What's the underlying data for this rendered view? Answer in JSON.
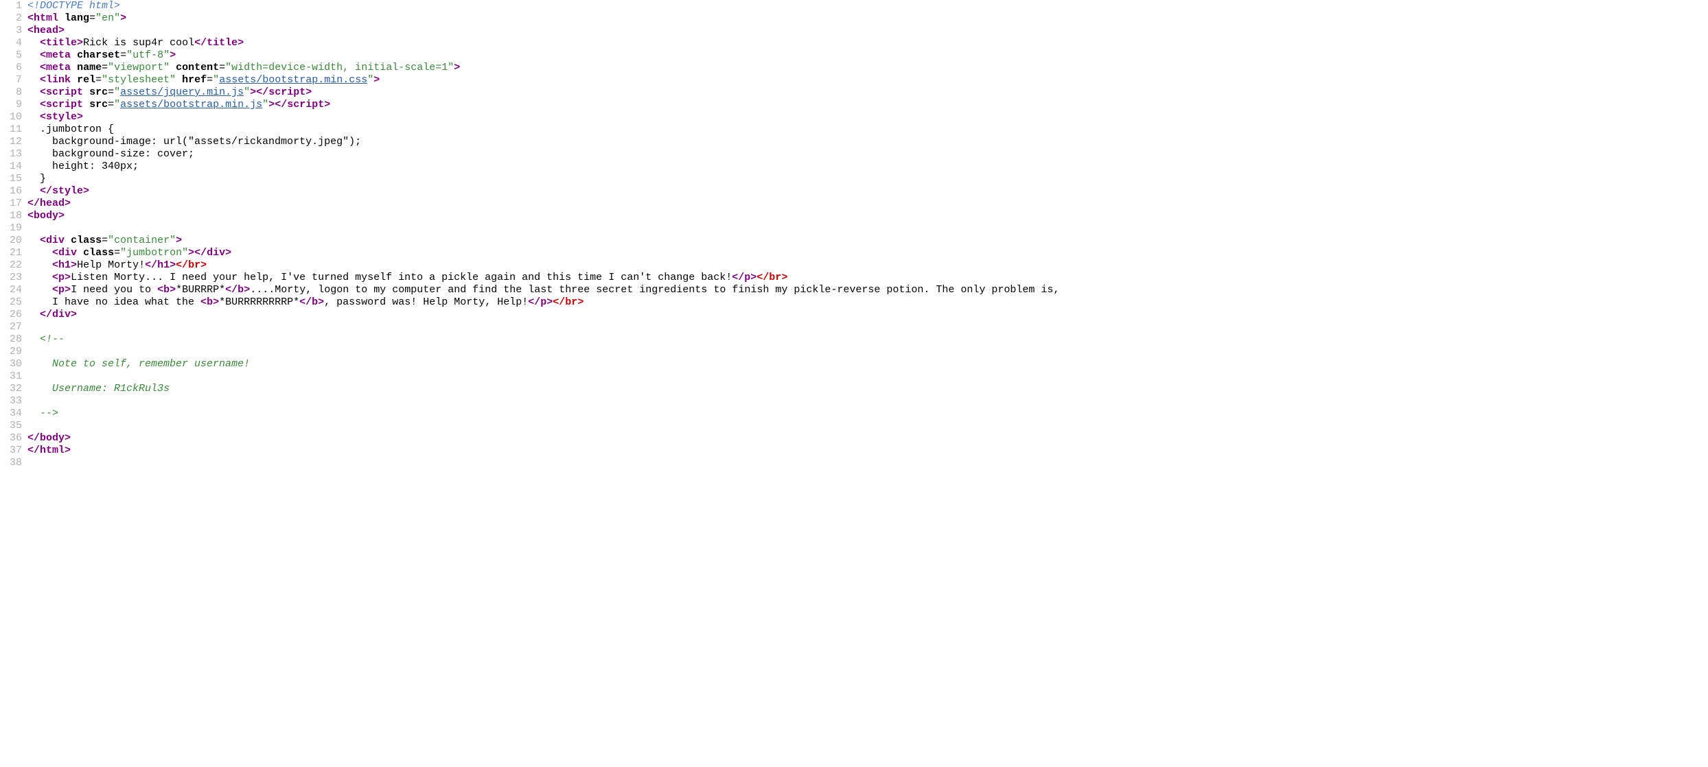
{
  "lines": [
    {
      "n": 1,
      "tokens": [
        {
          "t": "<!DOCTYPE html>",
          "c": "doctype"
        }
      ]
    },
    {
      "n": 2,
      "tokens": [
        {
          "t": "<",
          "c": "tag-bracket"
        },
        {
          "t": "html",
          "c": "tag-name"
        },
        {
          "t": " ",
          "c": "plain"
        },
        {
          "t": "lang",
          "c": "attr-name"
        },
        {
          "t": "=",
          "c": "attr-eq"
        },
        {
          "t": "\"en\"",
          "c": "attr-val"
        },
        {
          "t": ">",
          "c": "tag-bracket"
        }
      ]
    },
    {
      "n": 3,
      "tokens": [
        {
          "t": "<",
          "c": "tag-bracket"
        },
        {
          "t": "head",
          "c": "tag-name"
        },
        {
          "t": ">",
          "c": "tag-bracket"
        }
      ]
    },
    {
      "n": 4,
      "tokens": [
        {
          "t": "  ",
          "c": "plain"
        },
        {
          "t": "<",
          "c": "tag-bracket"
        },
        {
          "t": "title",
          "c": "tag-name"
        },
        {
          "t": ">",
          "c": "tag-bracket"
        },
        {
          "t": "Rick is sup4r cool",
          "c": "plain"
        },
        {
          "t": "</",
          "c": "tag-bracket"
        },
        {
          "t": "title",
          "c": "tag-name"
        },
        {
          "t": ">",
          "c": "tag-bracket"
        }
      ]
    },
    {
      "n": 5,
      "tokens": [
        {
          "t": "  ",
          "c": "plain"
        },
        {
          "t": "<",
          "c": "tag-bracket"
        },
        {
          "t": "meta",
          "c": "tag-name"
        },
        {
          "t": " ",
          "c": "plain"
        },
        {
          "t": "charset",
          "c": "attr-name"
        },
        {
          "t": "=",
          "c": "attr-eq"
        },
        {
          "t": "\"utf-8\"",
          "c": "attr-val"
        },
        {
          "t": ">",
          "c": "tag-bracket"
        }
      ]
    },
    {
      "n": 6,
      "tokens": [
        {
          "t": "  ",
          "c": "plain"
        },
        {
          "t": "<",
          "c": "tag-bracket"
        },
        {
          "t": "meta",
          "c": "tag-name"
        },
        {
          "t": " ",
          "c": "plain"
        },
        {
          "t": "name",
          "c": "attr-name"
        },
        {
          "t": "=",
          "c": "attr-eq"
        },
        {
          "t": "\"viewport\"",
          "c": "attr-val"
        },
        {
          "t": " ",
          "c": "plain"
        },
        {
          "t": "content",
          "c": "attr-name"
        },
        {
          "t": "=",
          "c": "attr-eq"
        },
        {
          "t": "\"width=device-width, initial-scale=1\"",
          "c": "attr-val"
        },
        {
          "t": ">",
          "c": "tag-bracket"
        }
      ]
    },
    {
      "n": 7,
      "tokens": [
        {
          "t": "  ",
          "c": "plain"
        },
        {
          "t": "<",
          "c": "tag-bracket"
        },
        {
          "t": "link",
          "c": "tag-name"
        },
        {
          "t": " ",
          "c": "plain"
        },
        {
          "t": "rel",
          "c": "attr-name"
        },
        {
          "t": "=",
          "c": "attr-eq"
        },
        {
          "t": "\"stylesheet\"",
          "c": "attr-val"
        },
        {
          "t": " ",
          "c": "plain"
        },
        {
          "t": "href",
          "c": "attr-name"
        },
        {
          "t": "=",
          "c": "attr-eq"
        },
        {
          "t": "\"",
          "c": "attr-val"
        },
        {
          "t": "assets/bootstrap.min.css",
          "c": "attr-val-link"
        },
        {
          "t": "\"",
          "c": "attr-val"
        },
        {
          "t": ">",
          "c": "tag-bracket"
        }
      ]
    },
    {
      "n": 8,
      "tokens": [
        {
          "t": "  ",
          "c": "plain"
        },
        {
          "t": "<",
          "c": "tag-bracket"
        },
        {
          "t": "script",
          "c": "tag-name"
        },
        {
          "t": " ",
          "c": "plain"
        },
        {
          "t": "src",
          "c": "attr-name"
        },
        {
          "t": "=",
          "c": "attr-eq"
        },
        {
          "t": "\"",
          "c": "attr-val"
        },
        {
          "t": "assets/jquery.min.js",
          "c": "attr-val-link"
        },
        {
          "t": "\"",
          "c": "attr-val"
        },
        {
          "t": ">",
          "c": "tag-bracket"
        },
        {
          "t": "</",
          "c": "tag-bracket"
        },
        {
          "t": "script",
          "c": "tag-name"
        },
        {
          "t": ">",
          "c": "tag-bracket"
        }
      ]
    },
    {
      "n": 9,
      "tokens": [
        {
          "t": "  ",
          "c": "plain"
        },
        {
          "t": "<",
          "c": "tag-bracket"
        },
        {
          "t": "script",
          "c": "tag-name"
        },
        {
          "t": " ",
          "c": "plain"
        },
        {
          "t": "src",
          "c": "attr-name"
        },
        {
          "t": "=",
          "c": "attr-eq"
        },
        {
          "t": "\"",
          "c": "attr-val"
        },
        {
          "t": "assets/bootstrap.min.js",
          "c": "attr-val-link"
        },
        {
          "t": "\"",
          "c": "attr-val"
        },
        {
          "t": ">",
          "c": "tag-bracket"
        },
        {
          "t": "</",
          "c": "tag-bracket"
        },
        {
          "t": "script",
          "c": "tag-name"
        },
        {
          "t": ">",
          "c": "tag-bracket"
        }
      ]
    },
    {
      "n": 10,
      "tokens": [
        {
          "t": "  ",
          "c": "plain"
        },
        {
          "t": "<",
          "c": "tag-bracket"
        },
        {
          "t": "style",
          "c": "tag-name"
        },
        {
          "t": ">",
          "c": "tag-bracket"
        }
      ]
    },
    {
      "n": 11,
      "tokens": [
        {
          "t": "  .jumbotron {",
          "c": "plain"
        }
      ]
    },
    {
      "n": 12,
      "tokens": [
        {
          "t": "    background-image: url(\"assets/rickandmorty.jpeg\");",
          "c": "plain"
        }
      ]
    },
    {
      "n": 13,
      "tokens": [
        {
          "t": "    background-size: cover;",
          "c": "plain"
        }
      ]
    },
    {
      "n": 14,
      "tokens": [
        {
          "t": "    height: 340px;",
          "c": "plain"
        }
      ]
    },
    {
      "n": 15,
      "tokens": [
        {
          "t": "  }",
          "c": "plain"
        }
      ]
    },
    {
      "n": 16,
      "tokens": [
        {
          "t": "  ",
          "c": "plain"
        },
        {
          "t": "</",
          "c": "tag-bracket"
        },
        {
          "t": "style",
          "c": "tag-name"
        },
        {
          "t": ">",
          "c": "tag-bracket"
        }
      ]
    },
    {
      "n": 17,
      "tokens": [
        {
          "t": "</",
          "c": "tag-bracket"
        },
        {
          "t": "head",
          "c": "tag-name"
        },
        {
          "t": ">",
          "c": "tag-bracket"
        }
      ]
    },
    {
      "n": 18,
      "tokens": [
        {
          "t": "<",
          "c": "tag-bracket"
        },
        {
          "t": "body",
          "c": "tag-name"
        },
        {
          "t": ">",
          "c": "tag-bracket"
        }
      ]
    },
    {
      "n": 19,
      "tokens": []
    },
    {
      "n": 20,
      "tokens": [
        {
          "t": "  ",
          "c": "plain"
        },
        {
          "t": "<",
          "c": "tag-bracket"
        },
        {
          "t": "div",
          "c": "tag-name"
        },
        {
          "t": " ",
          "c": "plain"
        },
        {
          "t": "class",
          "c": "attr-name"
        },
        {
          "t": "=",
          "c": "attr-eq"
        },
        {
          "t": "\"container\"",
          "c": "attr-val"
        },
        {
          "t": ">",
          "c": "tag-bracket"
        }
      ]
    },
    {
      "n": 21,
      "tokens": [
        {
          "t": "    ",
          "c": "plain"
        },
        {
          "t": "<",
          "c": "tag-bracket"
        },
        {
          "t": "div",
          "c": "tag-name"
        },
        {
          "t": " ",
          "c": "plain"
        },
        {
          "t": "class",
          "c": "attr-name"
        },
        {
          "t": "=",
          "c": "attr-eq"
        },
        {
          "t": "\"jumbotron\"",
          "c": "attr-val"
        },
        {
          "t": ">",
          "c": "tag-bracket"
        },
        {
          "t": "</",
          "c": "tag-bracket"
        },
        {
          "t": "div",
          "c": "tag-name"
        },
        {
          "t": ">",
          "c": "tag-bracket"
        }
      ]
    },
    {
      "n": 22,
      "tokens": [
        {
          "t": "    ",
          "c": "plain"
        },
        {
          "t": "<",
          "c": "tag-bracket"
        },
        {
          "t": "h1",
          "c": "tag-name"
        },
        {
          "t": ">",
          "c": "tag-bracket"
        },
        {
          "t": "Help Morty!",
          "c": "plain"
        },
        {
          "t": "</",
          "c": "tag-bracket"
        },
        {
          "t": "h1",
          "c": "tag-name"
        },
        {
          "t": ">",
          "c": "tag-bracket"
        },
        {
          "t": "</",
          "c": "err-tag"
        },
        {
          "t": "br",
          "c": "err-tag"
        },
        {
          "t": ">",
          "c": "err-tag"
        }
      ]
    },
    {
      "n": 23,
      "tokens": [
        {
          "t": "    ",
          "c": "plain"
        },
        {
          "t": "<",
          "c": "tag-bracket"
        },
        {
          "t": "p",
          "c": "tag-name"
        },
        {
          "t": ">",
          "c": "tag-bracket"
        },
        {
          "t": "Listen Morty... I need your help, I've turned myself into a pickle again and this time I can't change back!",
          "c": "plain"
        },
        {
          "t": "</",
          "c": "tag-bracket"
        },
        {
          "t": "p",
          "c": "tag-name"
        },
        {
          "t": ">",
          "c": "tag-bracket"
        },
        {
          "t": "</",
          "c": "err-tag"
        },
        {
          "t": "br",
          "c": "err-tag"
        },
        {
          "t": ">",
          "c": "err-tag"
        }
      ]
    },
    {
      "n": 24,
      "tokens": [
        {
          "t": "    ",
          "c": "plain"
        },
        {
          "t": "<",
          "c": "tag-bracket"
        },
        {
          "t": "p",
          "c": "tag-name"
        },
        {
          "t": ">",
          "c": "tag-bracket"
        },
        {
          "t": "I need you to ",
          "c": "plain"
        },
        {
          "t": "<",
          "c": "tag-bracket"
        },
        {
          "t": "b",
          "c": "tag-name"
        },
        {
          "t": ">",
          "c": "tag-bracket"
        },
        {
          "t": "*BURRRP*",
          "c": "plain"
        },
        {
          "t": "</",
          "c": "tag-bracket"
        },
        {
          "t": "b",
          "c": "tag-name"
        },
        {
          "t": ">",
          "c": "tag-bracket"
        },
        {
          "t": "....Morty, logon to my computer and find the last three secret ingredients to finish my pickle-reverse potion. The only problem is,",
          "c": "plain"
        }
      ]
    },
    {
      "n": 25,
      "tokens": [
        {
          "t": "    I have no idea what the ",
          "c": "plain"
        },
        {
          "t": "<",
          "c": "tag-bracket"
        },
        {
          "t": "b",
          "c": "tag-name"
        },
        {
          "t": ">",
          "c": "tag-bracket"
        },
        {
          "t": "*BURRRRRRRRP*",
          "c": "plain"
        },
        {
          "t": "</",
          "c": "tag-bracket"
        },
        {
          "t": "b",
          "c": "tag-name"
        },
        {
          "t": ">",
          "c": "tag-bracket"
        },
        {
          "t": ", password was! Help Morty, Help!",
          "c": "plain"
        },
        {
          "t": "</",
          "c": "tag-bracket"
        },
        {
          "t": "p",
          "c": "tag-name"
        },
        {
          "t": ">",
          "c": "tag-bracket"
        },
        {
          "t": "</",
          "c": "err-tag"
        },
        {
          "t": "br",
          "c": "err-tag"
        },
        {
          "t": ">",
          "c": "err-tag"
        }
      ]
    },
    {
      "n": 26,
      "tokens": [
        {
          "t": "  ",
          "c": "plain"
        },
        {
          "t": "</",
          "c": "tag-bracket"
        },
        {
          "t": "div",
          "c": "tag-name"
        },
        {
          "t": ">",
          "c": "tag-bracket"
        }
      ]
    },
    {
      "n": 27,
      "tokens": []
    },
    {
      "n": 28,
      "tokens": [
        {
          "t": "  ",
          "c": "plain"
        },
        {
          "t": "<!--",
          "c": "comment"
        }
      ]
    },
    {
      "n": 29,
      "tokens": []
    },
    {
      "n": 30,
      "tokens": [
        {
          "t": "    Note to self, remember username!",
          "c": "comment"
        }
      ]
    },
    {
      "n": 31,
      "tokens": []
    },
    {
      "n": 32,
      "tokens": [
        {
          "t": "    Username: R1ckRul3s",
          "c": "comment"
        }
      ]
    },
    {
      "n": 33,
      "tokens": []
    },
    {
      "n": 34,
      "tokens": [
        {
          "t": "  -->",
          "c": "comment"
        }
      ]
    },
    {
      "n": 35,
      "tokens": []
    },
    {
      "n": 36,
      "tokens": [
        {
          "t": "</",
          "c": "tag-bracket"
        },
        {
          "t": "body",
          "c": "tag-name"
        },
        {
          "t": ">",
          "c": "tag-bracket"
        }
      ]
    },
    {
      "n": 37,
      "tokens": [
        {
          "t": "</",
          "c": "tag-bracket"
        },
        {
          "t": "html",
          "c": "tag-name"
        },
        {
          "t": ">",
          "c": "tag-bracket"
        }
      ]
    },
    {
      "n": 38,
      "tokens": []
    }
  ]
}
